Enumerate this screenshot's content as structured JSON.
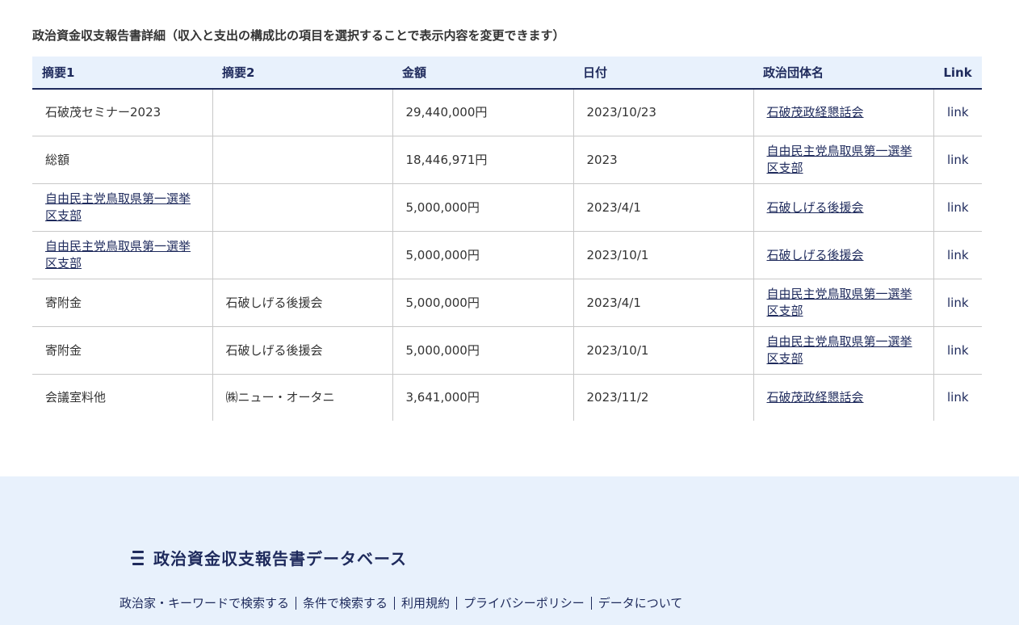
{
  "section_title": "政治資金収支報告書詳細（収入と支出の構成比の項目を選択することで表示内容を変更できます）",
  "table": {
    "headers": [
      "摘要1",
      "摘要2",
      "金額",
      "日付",
      "政治団体名",
      "Link"
    ],
    "rows": [
      {
        "summary1": "石破茂セミナー2023",
        "summary2": "",
        "amount": "29,440,000円",
        "date": "2023/10/23",
        "org": "石破茂政経懇話会",
        "link": "link"
      },
      {
        "summary1": "総額",
        "summary2": "",
        "amount": "18,446,971円",
        "date": "2023",
        "org": "自由民主党鳥取県第一選挙区支部",
        "link": "link"
      },
      {
        "summary1": "自由民主党鳥取県第一選挙区支部",
        "summary2": "",
        "amount": "5,000,000円",
        "date": "2023/4/1",
        "org": "石破しげる後援会",
        "link": "link"
      },
      {
        "summary1": "自由民主党鳥取県第一選挙区支部",
        "summary2": "",
        "amount": "5,000,000円",
        "date": "2023/10/1",
        "org": "石破しげる後援会",
        "link": "link"
      },
      {
        "summary1": "寄附金",
        "summary2": "石破しげる後援会",
        "amount": "5,000,000円",
        "date": "2023/4/1",
        "org": "自由民主党鳥取県第一選挙区支部",
        "link": "link"
      },
      {
        "summary1": "寄附金",
        "summary2": "石破しげる後援会",
        "amount": "5,000,000円",
        "date": "2023/10/1",
        "org": "自由民主党鳥取県第一選挙区支部",
        "link": "link"
      },
      {
        "summary1": "会議室料他",
        "summary2": "㈱ニュー・オータニ",
        "amount": "3,641,000円",
        "date": "2023/11/2",
        "org": "石破茂政経懇話会",
        "link": "link"
      }
    ]
  },
  "footer": {
    "brand_icon": "stacked-lines-logo-icon",
    "brand_name": "政治資金収支報告書データベース",
    "nav": [
      "政治家・キーワードで検索する",
      "条件で検索する",
      "利用規約",
      "プライバシーポリシー",
      "データについて"
    ]
  },
  "colors": {
    "accent": "#1e2a5c",
    "header_bg": "#e8f1fc",
    "footer_bg": "#e8f1fc",
    "border": "#c8c8c8",
    "text": "#333333"
  }
}
